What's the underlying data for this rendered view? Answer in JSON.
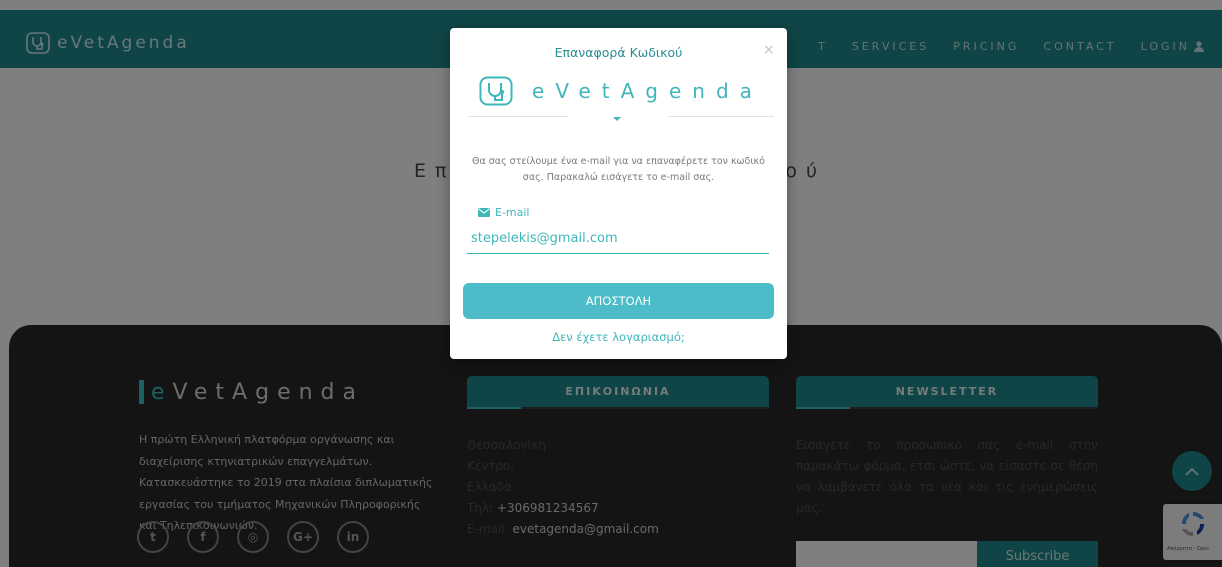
{
  "header": {
    "brand": "eVetAgenda",
    "nav": [
      "T",
      "SERVICES",
      "PRICING",
      "CONTACT",
      "LOGIN"
    ]
  },
  "page": {
    "heading_left": "Επ",
    "heading_right": "ού"
  },
  "footer": {
    "brand_e": "e",
    "brand_rest": "VetAgenda",
    "about": "Η πρώτη Ελληνική πλατφόρμα οργάνωσης και διαχείρισης κτηνιατρικών επαγγελμάτων. Κατασκευάστηκε το 2019 στα πλαίσια διπλωματικής εργασίας του τμήματος Μηχανικών Πληροφορικής και Τηλεπικοινωνιών.",
    "contact_title": "ΕΠΙΚΟΙΝΩΝΙΑ",
    "contact_city": "Θεσσαλονίκη",
    "contact_area": "Κέντρο,",
    "contact_country": "Ελλάδα",
    "contact_phone_label": "Τηλ:",
    "contact_phone": "+306981234567",
    "contact_email_label": "E-mail:",
    "contact_email": "evetagenda@gmail.com",
    "newsletter_title": "NEWSLETTER",
    "newsletter_text": "Εισάγετε το προσωπικό σας e-mail στην παρακάτω φόρμα, έτσι ώστε, να είσαστε σε θέση να λαμβάνετε όλα τα νέα και τις ενημερώσεις μας.",
    "subscribe_label": "Subscribe",
    "social": [
      "twitter-icon",
      "facebook-icon",
      "instagram-icon",
      "google-plus-icon",
      "linkedin-icon"
    ]
  },
  "recaptcha": {
    "text": "Απόρρητο - Όροι"
  },
  "modal": {
    "title": "Επαναφορά Κωδικού",
    "close": "×",
    "logo_e": "e",
    "logo_rest": "VetAgenda",
    "description": "Θα σας στείλουμε ένα e-mail για να επαναφέρετε τον κωδικό σας. Παρακαλώ εισάγετε το e-mail σας.",
    "email_label": "E-mail",
    "email_value": "stepelekis@gmail.com",
    "submit_label": "ΑΠΟΣΤΟΛΗ",
    "register_link": "Δεν έχετε λογαριασμό;"
  },
  "colors": {
    "brand_teal": "#1f8a8d",
    "accent": "#3fb6ba",
    "footer_bg": "#292929"
  }
}
